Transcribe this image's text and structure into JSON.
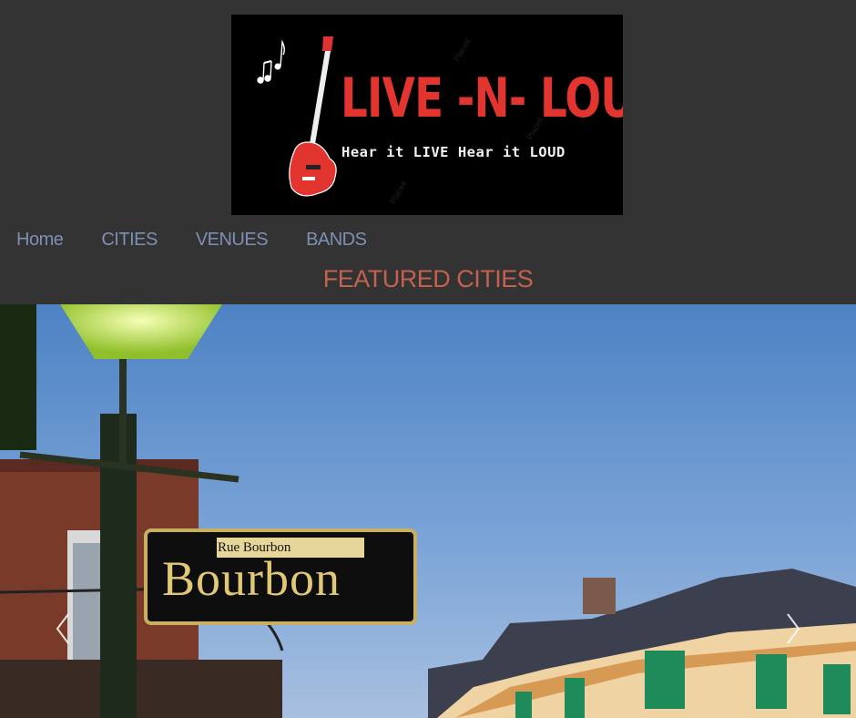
{
  "logo": {
    "title": "LIVE -N- LOUD",
    "tagline": "Hear it LIVE Hear it LOUD",
    "watermark": "Placeit"
  },
  "nav": {
    "items": [
      {
        "label": "Home"
      },
      {
        "label": "CITIES"
      },
      {
        "label": "VENUES"
      },
      {
        "label": "BANDS"
      }
    ]
  },
  "main": {
    "heading": "FEATURED CITIES"
  },
  "carousel": {
    "slide": {
      "sign_small": "Rue Bourbon",
      "sign_big": "Bourbon"
    },
    "prev_icon": "chevron-left-icon",
    "next_icon": "chevron-right-icon"
  },
  "colors": {
    "page_bg": "#333333",
    "nav_link": "#7e8fb4",
    "heading": "#c4614f",
    "logo_red": "#e2352f"
  }
}
